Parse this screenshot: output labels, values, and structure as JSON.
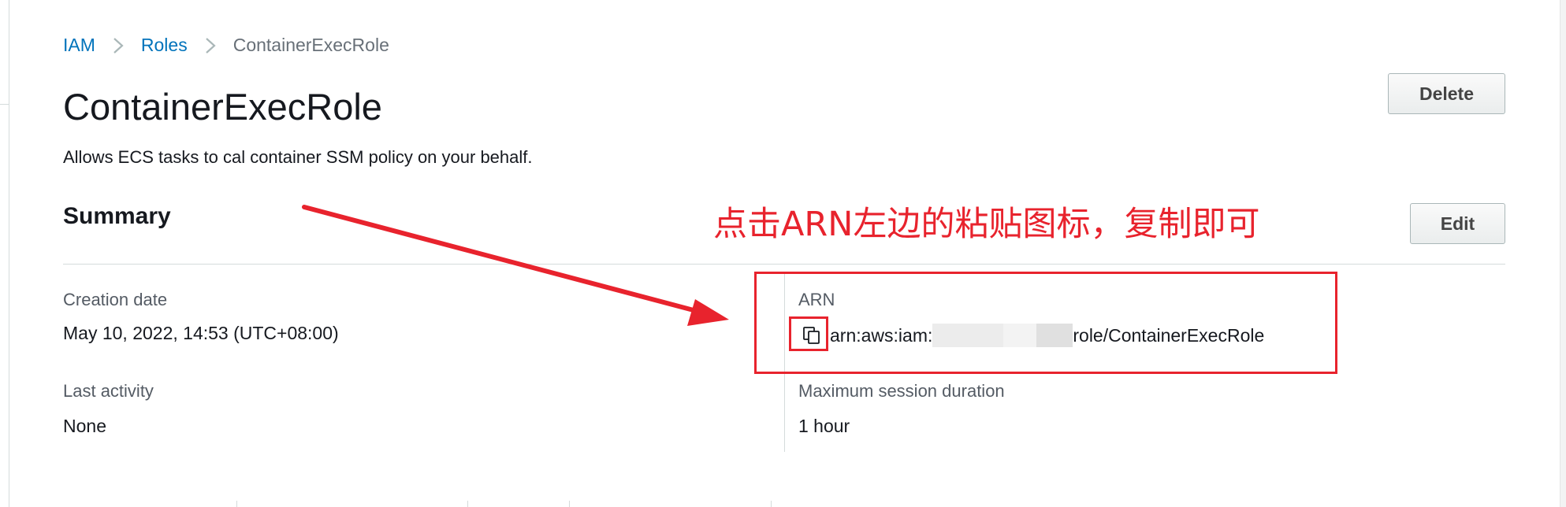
{
  "breadcrumb": {
    "items": [
      {
        "label": "IAM"
      },
      {
        "label": "Roles"
      },
      {
        "label": "ContainerExecRole"
      }
    ]
  },
  "page": {
    "title": "ContainerExecRole",
    "description": "Allows ECS tasks to cal container SSM policy on your behalf."
  },
  "actions": {
    "delete_label": "Delete",
    "edit_label": "Edit"
  },
  "summary": {
    "title": "Summary",
    "creation_date": {
      "label": "Creation date",
      "value": "May 10, 2022, 14:53 (UTC+08:00)"
    },
    "last_activity": {
      "label": "Last activity",
      "value": "None"
    },
    "arn": {
      "label": "ARN",
      "prefix": "arn:aws:iam:",
      "suffix": "role/ContainerExecRole",
      "icon": "copy-icon"
    },
    "max_session": {
      "label": "Maximum session duration",
      "value": "1 hour"
    }
  },
  "annotation": {
    "text": "点击ARN左边的粘贴图标，复制即可",
    "color": "#e8232d"
  },
  "colors": {
    "link": "#0073bb",
    "muted": "#687078",
    "text": "#16191f"
  }
}
